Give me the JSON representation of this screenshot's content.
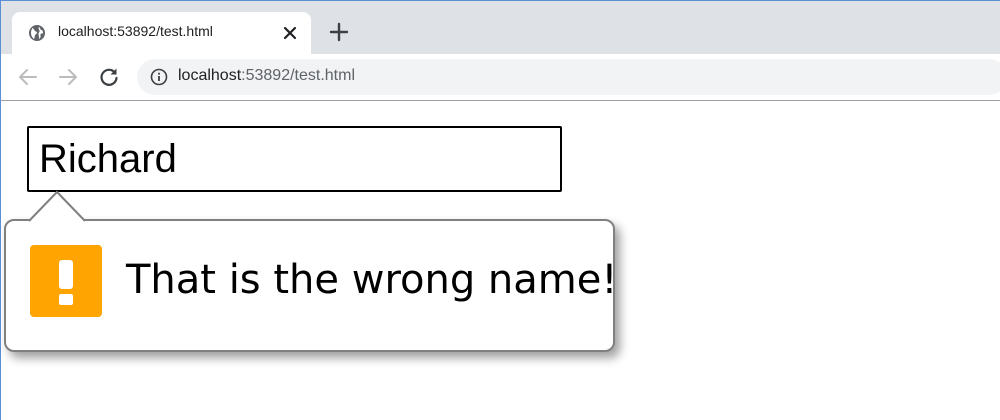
{
  "browser": {
    "tab": {
      "title": "localhost:53892/test.html",
      "favicon": "globe-icon",
      "close_icon": "close-icon"
    },
    "new_tab_icon": "plus-icon",
    "toolbar": {
      "back_icon": "arrow-left-icon",
      "forward_icon": "arrow-right-icon",
      "reload_icon": "reload-icon",
      "site_info_icon": "info-icon",
      "url_host": "localhost",
      "url_rest": ":53892/test.html"
    },
    "colors": {
      "tabstrip": "#dee1e6",
      "omnibox": "#f1f3f4"
    }
  },
  "page": {
    "name_input": {
      "value": "Richard"
    },
    "validation_bubble": {
      "message": "That is the wrong name!",
      "icon": "warning-icon",
      "icon_color": "#ffa400"
    }
  }
}
